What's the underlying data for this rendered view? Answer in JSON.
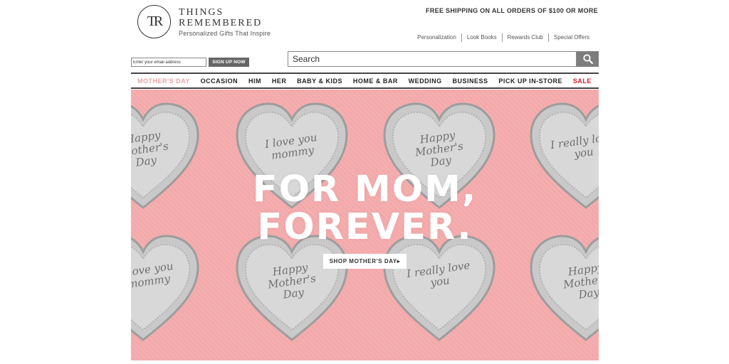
{
  "brand": {
    "monogram": "TR",
    "name_line1": "THINGS",
    "name_line2": "REMEMBERED",
    "tagline": "Personalized Gifts That Inspire"
  },
  "promo": "FREE SHIPPING ON ALL ORDERS OF $100 OR MORE",
  "util_links": [
    "Personalization",
    "Look Books",
    "Rewards Club",
    "Special Offers"
  ],
  "newsletter": {
    "placeholder": "Enter your email address",
    "button_label": "SIGN UP NOW"
  },
  "search": {
    "placeholder": "Search",
    "icon": "search-icon"
  },
  "nav": {
    "items": [
      "MOTHER'S DAY",
      "OCCASION",
      "HIM",
      "HER",
      "BABY & KIDS",
      "HOME & BAR",
      "WEDDING",
      "BUSINESS",
      "PICK UP IN-STORE",
      "SALE"
    ],
    "active_color": "#e8a3a3",
    "sale_color": "#d61a2a"
  },
  "hero": {
    "title_line1": "FOR MOM,",
    "title_line2": "FOREVER.",
    "cta_label": "SHOP MOTHER'S DAY▸",
    "background": "#f3a9aa",
    "engravings": [
      "Happy Mother's Day",
      "I love you mommy",
      "Happy Mother's Day",
      "I really love you",
      "I love you mommy",
      "Happy Mother's Day",
      "I really love you",
      "Happy Mother's Day"
    ]
  }
}
